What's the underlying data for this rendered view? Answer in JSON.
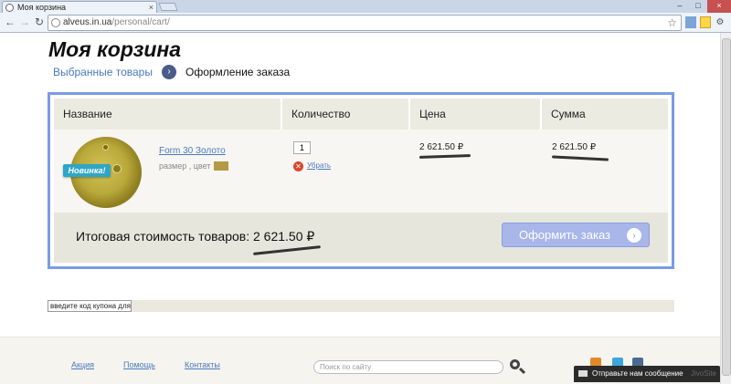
{
  "browser": {
    "tab_title": "Моя корзина",
    "tab_close": "×",
    "url_host": "alveus.in.ua",
    "url_path": "/personal/cart/",
    "back": "←",
    "forward": "→",
    "reload": "↻",
    "star": "☆",
    "window_min": "–",
    "window_max": "□",
    "window_close": "×"
  },
  "page": {
    "title": "Моя корзина",
    "breadcrumb": {
      "step1": "Выбранные товары",
      "separator": "›",
      "step2": "Оформление заказа"
    }
  },
  "cart": {
    "columns": [
      "Название",
      "Количество",
      "Цена",
      "Сумма"
    ],
    "item": {
      "badge": "Новинка!",
      "name": "Form 30 Золото",
      "props": "размер , цвет",
      "swatch_color": "#b49a44",
      "quantity": "1",
      "remove_label": "Убрать",
      "price": "2 621.50 ₽",
      "sum": "2 621.50 ₽"
    },
    "total_label": "Итоговая стоимость товаров: 2 621.50 ₽",
    "order_button": "Оформить заказ",
    "order_button_arrow": "›"
  },
  "coupon": {
    "placeholder": "введите код купона для скидки"
  },
  "footer": {
    "links": [
      "Акция",
      "Помощь",
      "Контакты"
    ],
    "search_placeholder": "Поиск по сайту"
  },
  "chat": {
    "label": "Отправьте нам сообщение",
    "brand": "JivoSite"
  },
  "colors": {
    "accent": "#4a7ac0",
    "cart_border": "#7c9ae6",
    "order_button": "#a8b6ea",
    "badge": "#2fa6c5"
  }
}
